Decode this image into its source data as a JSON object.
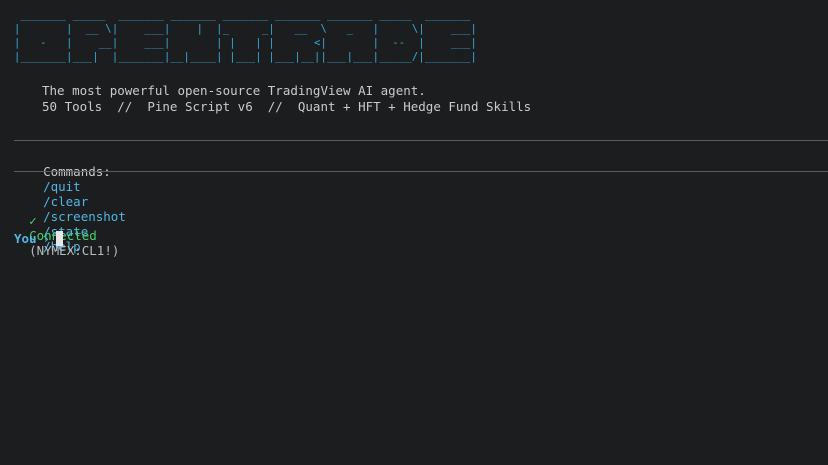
{
  "banner": {
    "ascii": " _______ _____  _______ _______ _______ _______ _______ _____  _______\n|       |  __ \\|    ___|    |  |_     _|   __  \\   _   |     \\|    ___|\n|   -   |    __|    ___|       | |   | |      <|       |  --  |    ___|\n|_______|___|  |_______|__|____| |___| |___|__||___|___|_____/|_______|",
    "color": "#3aa8d8"
  },
  "tagline": {
    "line1": "The most powerful open-source TradingView AI agent.",
    "line2": "50 Tools  //  Pine Script v6  //  Quant + HFT + Hedge Fund Skills"
  },
  "commands": {
    "label": "Commands:",
    "items": [
      "/quit",
      "/clear",
      "/screenshot",
      "/state",
      "/help"
    ]
  },
  "status": {
    "check_icon": "✓",
    "text": "Connected",
    "symbol": "(NYMEX:CL1!)"
  },
  "prompt": {
    "label": "You",
    "chevron": "›"
  },
  "colors": {
    "background": "#1b1d1f",
    "accent": "#4fb6e6",
    "success": "#4ccd6a",
    "text": "#c8cacc"
  }
}
